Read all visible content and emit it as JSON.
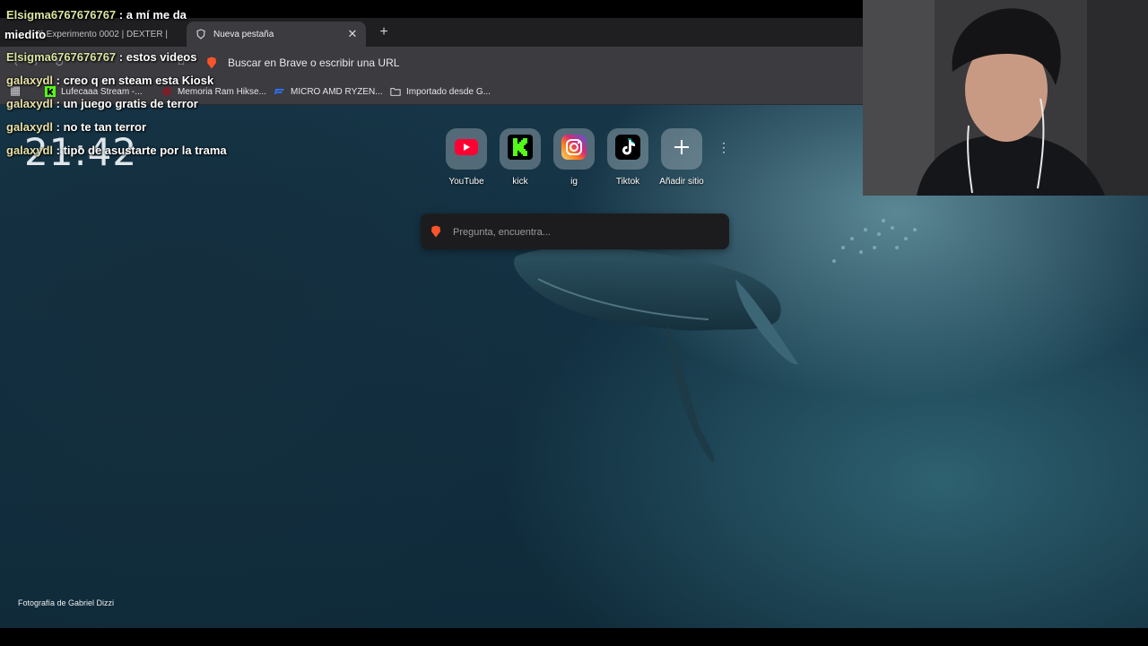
{
  "tabs": [
    {
      "title": "3) Experimento 0002 | DEXTER |",
      "active": false
    },
    {
      "title": "Nueva pestaña",
      "active": true
    }
  ],
  "address_bar": {
    "text": "Buscar en Brave o escribir una URL"
  },
  "bookmarks": [
    {
      "label": "Lufecaaa Stream -..."
    },
    {
      "label": "Memoria Ram Hikse..."
    },
    {
      "label": "MICRO AMD RYZEN..."
    },
    {
      "label": "Importado desde G..."
    }
  ],
  "chat": [
    {
      "user": "Elsigma6767676767",
      "msg": " : a mí me da",
      "user_color": "#d9e6a0"
    },
    {
      "user": "",
      "msg": "miedito",
      "user_color": "#d9e6a0"
    },
    {
      "user": "Elsigma6767676767",
      "msg": " : estos videos",
      "user_color": "#d9e6a0"
    },
    {
      "user": "galaxydl",
      "msg": " : creo q en steam esta Kiosk",
      "user_color": "#e7e0a6"
    },
    {
      "user": "galaxydl",
      "msg": " : un juego gratis de terror",
      "user_color": "#e7e0a6"
    },
    {
      "user": "galaxydl",
      "msg": " : no te tan terror",
      "user_color": "#e7e0a6"
    },
    {
      "user": "galaxydl",
      "msg": " : tipo de asustarte por la trama",
      "user_color": "#e7e0a6"
    }
  ],
  "clock": {
    "time": "21:42"
  },
  "top_sites": [
    {
      "label": "YouTube",
      "icon": "youtube-icon"
    },
    {
      "label": "kick",
      "icon": "kick-icon"
    },
    {
      "label": "ig",
      "icon": "instagram-icon"
    },
    {
      "label": "Tiktok",
      "icon": "tiktok-icon"
    },
    {
      "label": "Añadir sitio",
      "icon": "plus-icon"
    }
  ],
  "search": {
    "placeholder": "Pregunta, encuentra..."
  },
  "photo_credit": "Fotografía de Gabriel Dizzi",
  "colors": {
    "brave_orange": "#fb542b",
    "kick_green": "#53fc18",
    "youtube_red": "#ff0033"
  }
}
